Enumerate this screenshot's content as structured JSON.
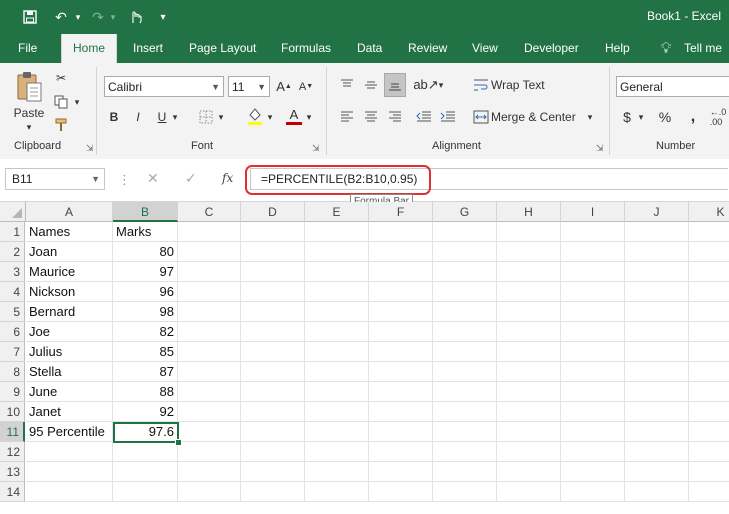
{
  "titlebar": {
    "title": "Book1  -  Excel",
    "save_icon": "save-icon",
    "undo_icon": "undo-icon",
    "redo_icon": "redo-icon",
    "touch_icon": "touch-mode-icon"
  },
  "tabs": {
    "items": [
      "File",
      "Home",
      "Insert",
      "Page Layout",
      "Formulas",
      "Data",
      "Review",
      "View",
      "Developer",
      "Help",
      "Tell me w"
    ],
    "active": "Home"
  },
  "ribbon": {
    "clipboard": {
      "label": "Clipboard",
      "paste": "Paste"
    },
    "font": {
      "label": "Font",
      "family": "Calibri",
      "size": "11",
      "bold": "B",
      "italic": "I",
      "underline": "U",
      "font_color_glyph": "A"
    },
    "alignment": {
      "label": "Alignment",
      "wrap_text": "Wrap Text",
      "merge_center": "Merge & Center"
    },
    "number": {
      "label": "Number",
      "format": "General",
      "currency": "$",
      "percent": "%",
      "comma": ","
    }
  },
  "formula_bar": {
    "name_box": "B11",
    "fx": "fx",
    "formula": "=PERCENTILE(B2:B10,0.95)",
    "tooltip": "Formula Bar"
  },
  "sheet": {
    "columns": [
      "A",
      "B",
      "C",
      "D",
      "E",
      "F",
      "G",
      "H",
      "I",
      "J",
      "K"
    ],
    "rows": [
      [
        "Names",
        "Marks"
      ],
      [
        "Joan",
        "80"
      ],
      [
        "Maurice",
        "97"
      ],
      [
        "Nickson",
        "96"
      ],
      [
        "Bernard",
        "98"
      ],
      [
        "Joe",
        "82"
      ],
      [
        "Julius",
        "85"
      ],
      [
        "Stella",
        "87"
      ],
      [
        "June",
        "88"
      ],
      [
        "Janet",
        "92"
      ],
      [
        "95 Percentile",
        "97.6"
      ],
      [
        "",
        ""
      ],
      [
        "",
        ""
      ],
      [
        "",
        ""
      ]
    ],
    "selected_cell": "B11",
    "colors": {
      "accent": "#217346",
      "highlight": "#e0302f"
    }
  }
}
